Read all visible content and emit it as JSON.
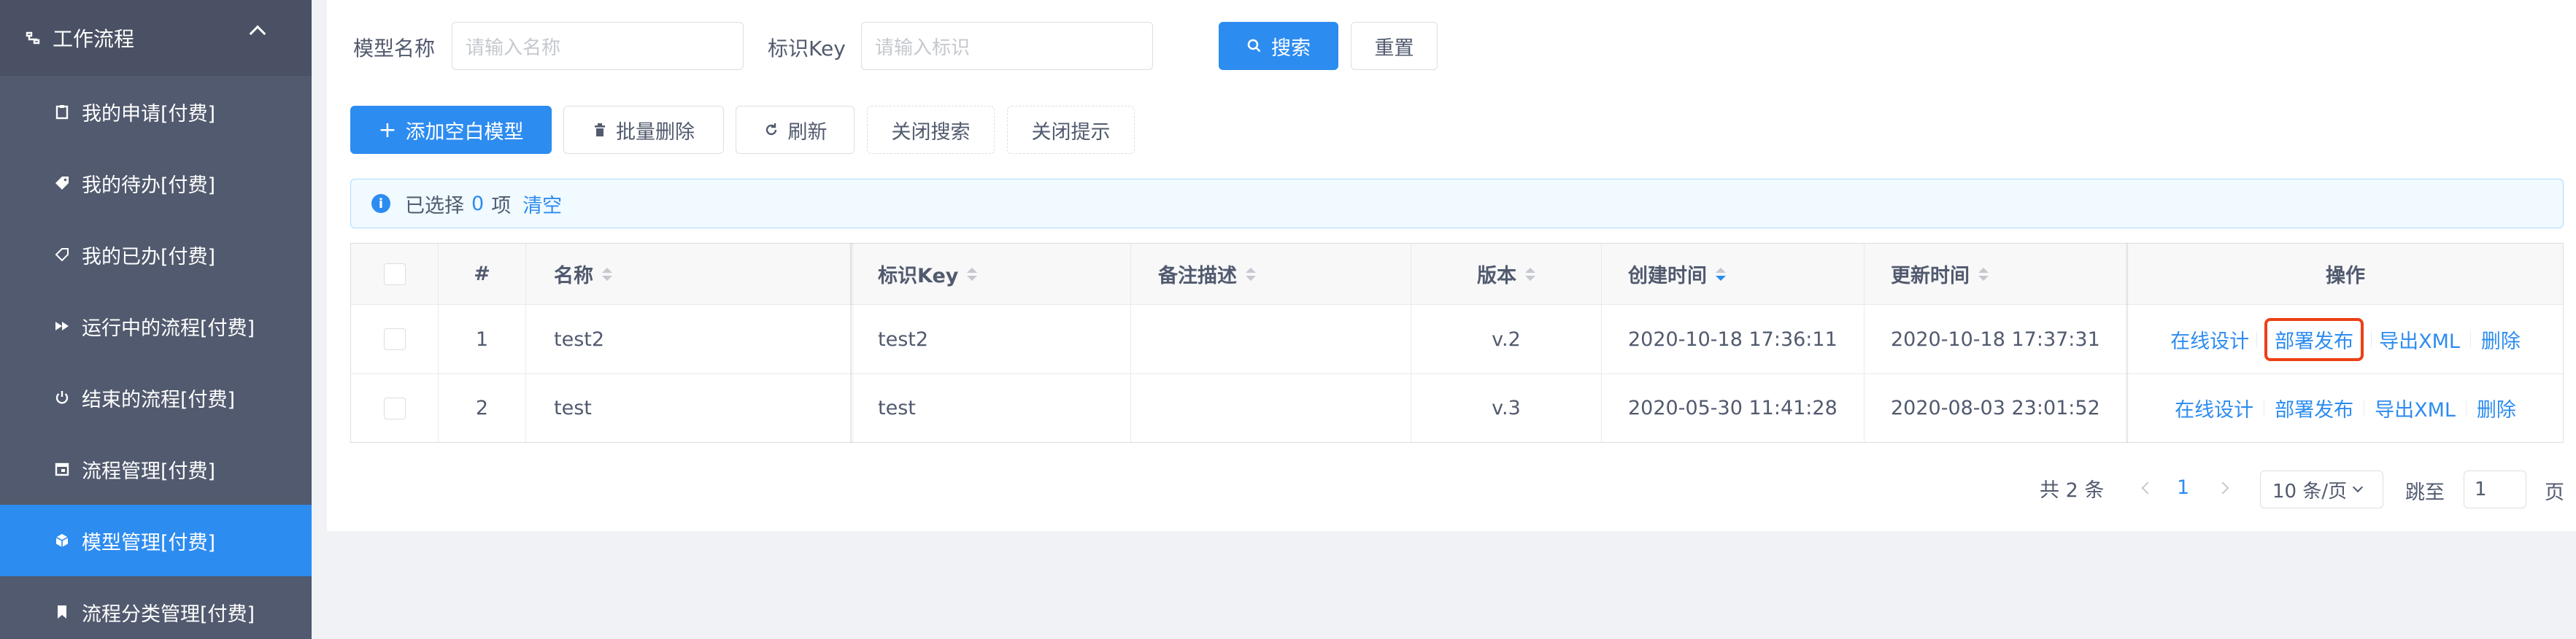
{
  "sidebar": {
    "group": {
      "label": "工作流程"
    },
    "items": [
      {
        "label": "我的申请[付费]",
        "icon": "clipboard-icon"
      },
      {
        "label": "我的待办[付费]",
        "icon": "tag-icon"
      },
      {
        "label": "我的已办[付费]",
        "icon": "tag-outline-icon"
      },
      {
        "label": "运行中的流程[付费]",
        "icon": "fast-forward-icon"
      },
      {
        "label": "结束的流程[付费]",
        "icon": "power-icon"
      },
      {
        "label": "流程管理[付费]",
        "icon": "calendar-icon"
      },
      {
        "label": "模型管理[付费]",
        "icon": "cube-icon",
        "active": true
      },
      {
        "label": "流程分类管理[付费]",
        "icon": "bookmark-icon"
      }
    ]
  },
  "search": {
    "model_name_label": "模型名称",
    "model_name_placeholder": "请输入名称",
    "key_label": "标识Key",
    "key_placeholder": "请输入标识",
    "search_button": "搜索",
    "reset_button": "重置"
  },
  "toolbar": {
    "add_model": "添加空白模型",
    "batch_delete": "批量删除",
    "refresh": "刷新",
    "close_search": "关闭搜索",
    "close_tips": "关闭提示"
  },
  "alert": {
    "prefix": "已选择",
    "count": "0",
    "suffix": "项",
    "clear": "清空"
  },
  "table": {
    "columns": [
      "#",
      "名称",
      "标识Key",
      "备注描述",
      "版本",
      "创建时间",
      "更新时间",
      "操作"
    ],
    "rows": [
      {
        "index": "1",
        "name": "test2",
        "key": "test2",
        "desc": "",
        "version": "v.2",
        "created": "2020-10-18 17:36:11",
        "updated": "2020-10-18 17:37:31"
      },
      {
        "index": "2",
        "name": "test",
        "key": "test",
        "desc": "",
        "version": "v.3",
        "created": "2020-05-30 11:41:28",
        "updated": "2020-08-03 23:01:52"
      }
    ],
    "actions": {
      "design": "在线设计",
      "deploy": "部署发布",
      "export": "导出XML",
      "delete": "删除"
    }
  },
  "pagination": {
    "total": "共 2 条",
    "current_page": "1",
    "page_size": "10 条/页",
    "jump_label": "跳至",
    "jump_value": "1",
    "page_suffix": "页"
  },
  "colors": {
    "primary": "#2d8cf0",
    "sidebar": "#515a6e",
    "highlight": "#ed3f14"
  }
}
